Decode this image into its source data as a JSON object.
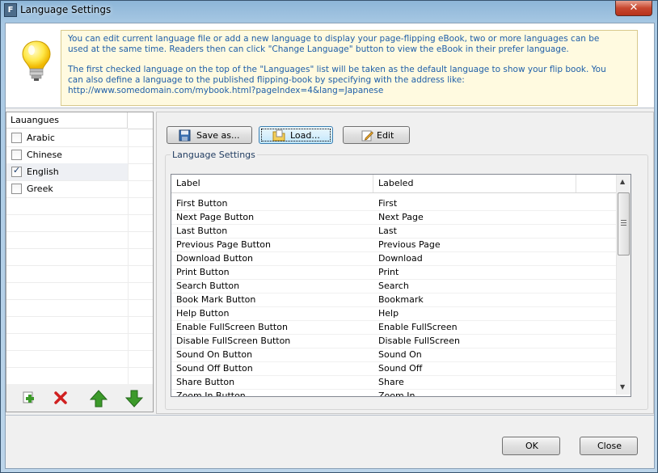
{
  "window": {
    "title": "Language Settings",
    "app_icon_letter": "F",
    "close_glyph": "✕"
  },
  "info": {
    "line1": "You can edit current language file or add a new language to display your page-flipping eBook, two or more languages can be",
    "line2": "used at the same time. Readers then can click \"Change Language\" button to view the eBook in their prefer language.",
    "line3": "The first checked language on the top of the \"Languages\" list will be taken as the default language to show your flip book. You",
    "line4": "can also define a language to the published flipping-book by specifying with the address like:",
    "line5": "http://www.somedomain.com/mybook.html?pageIndex=4&lang=Japanese"
  },
  "languages": {
    "header": "Lauangues",
    "items": [
      {
        "label": "Arabic",
        "checked": false
      },
      {
        "label": "Chinese",
        "checked": false
      },
      {
        "label": "English",
        "checked": true
      },
      {
        "label": "Greek",
        "checked": false
      }
    ],
    "toolbar_icons": [
      "add-icon",
      "delete-icon",
      "move-up-icon",
      "move-down-icon"
    ]
  },
  "toolbar": {
    "save_label": "Save as...",
    "load_label": "Load...",
    "edit_label": "Edit"
  },
  "settings": {
    "group_title": "Language Settings",
    "columns": [
      "Label",
      "Labeled"
    ],
    "rows": [
      [
        "First Button",
        "First"
      ],
      [
        "Next Page Button",
        "Next Page"
      ],
      [
        "Last Button",
        "Last"
      ],
      [
        "Previous Page Button",
        "Previous Page"
      ],
      [
        "Download Button",
        "Download"
      ],
      [
        "Print Button",
        "Print"
      ],
      [
        "Search Button",
        "Search"
      ],
      [
        "Book Mark Button",
        "Bookmark"
      ],
      [
        "Help Button",
        "Help"
      ],
      [
        "Enable FullScreen Button",
        "Enable FullScreen"
      ],
      [
        "Disable FullScreen Button",
        "Disable FullScreen"
      ],
      [
        "Sound On Button",
        "Sound On"
      ],
      [
        "Sound Off Button",
        "Sound Off"
      ],
      [
        "Share Button",
        "Share"
      ],
      [
        "Zoom In Button",
        "Zoom In"
      ]
    ]
  },
  "footer": {
    "ok_label": "OK",
    "close_label": "Close"
  },
  "colors": {
    "info_text": "#1f5fa8",
    "info_bg": "#fffae0",
    "close_red": "#c7472f",
    "up_green": "#3c9a2a",
    "delete_red": "#d02020"
  }
}
